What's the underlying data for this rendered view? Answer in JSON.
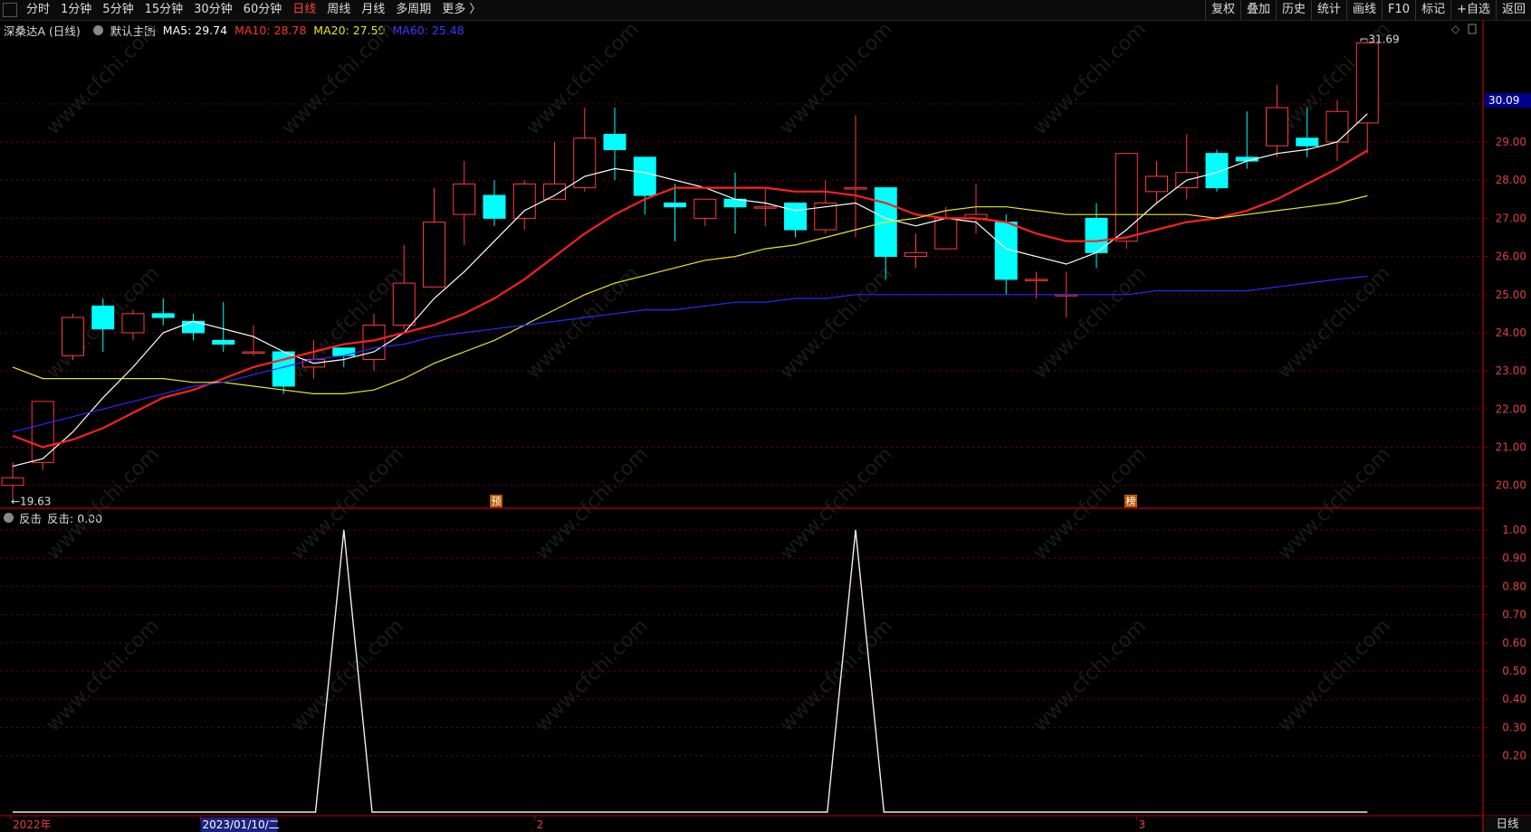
{
  "toolbar": {
    "left": [
      "分时",
      "1分钟",
      "5分钟",
      "15分钟",
      "30分钟",
      "60分钟",
      "日线",
      "周线",
      "月线",
      "多周期",
      "更多 〉"
    ],
    "active_index": 6,
    "right": [
      "复权",
      "叠加",
      "历史",
      "统计",
      "画线",
      "F10",
      "标记",
      "+自选",
      "返回"
    ]
  },
  "main_info": {
    "stock": "深桑达A (日线)",
    "template": "默认主图",
    "ma5": "MA5: 29.74",
    "ma10": "MA10: 28.78",
    "ma20": "MA20: 27.59",
    "ma60": "MA60: 25.48"
  },
  "sub_info": {
    "name": "反击",
    "value": "反击: 0.00"
  },
  "colors": {
    "up": "#ff3b3b",
    "down": "#00ffff",
    "ma5": "#ffffff",
    "ma10": "#ff2020",
    "ma20": "#e6e62a",
    "ma60": "#2a2aff",
    "grid": "#7a0000",
    "axis_text": "#e04040"
  },
  "chart_data": [
    {
      "type": "candlestick",
      "title": "深桑达A (日线)",
      "y_ticks": [
        "30.00",
        "29.00",
        "28.00",
        "27.00",
        "26.00",
        "25.00",
        "24.00",
        "23.00",
        "22.00",
        "21.00",
        "20.00"
      ],
      "ylim": [
        19.4,
        32.2
      ],
      "current_price": "30.09",
      "high_label": "31.69",
      "low_label": "←19.63",
      "markers": [
        "预",
        "榜"
      ],
      "candles": [
        {
          "o": 20.0,
          "c": 20.2,
          "h": 20.6,
          "l": 19.63
        },
        {
          "o": 20.6,
          "c": 22.2,
          "h": 22.2,
          "l": 20.4
        },
        {
          "o": 23.4,
          "c": 24.4,
          "h": 24.5,
          "l": 23.3
        },
        {
          "o": 24.7,
          "c": 24.1,
          "h": 24.9,
          "l": 23.5
        },
        {
          "o": 24.0,
          "c": 24.5,
          "h": 24.6,
          "l": 23.8
        },
        {
          "o": 24.5,
          "c": 24.4,
          "h": 24.9,
          "l": 24.2
        },
        {
          "o": 24.3,
          "c": 24.0,
          "h": 24.5,
          "l": 23.8
        },
        {
          "o": 23.8,
          "c": 23.7,
          "h": 24.8,
          "l": 23.5
        },
        {
          "o": 23.5,
          "c": 23.5,
          "h": 24.2,
          "l": 23.4
        },
        {
          "o": 23.5,
          "c": 22.6,
          "h": 23.5,
          "l": 22.4
        },
        {
          "o": 23.1,
          "c": 23.3,
          "h": 23.8,
          "l": 22.8
        },
        {
          "o": 23.6,
          "c": 23.4,
          "h": 23.6,
          "l": 23.1
        },
        {
          "o": 23.3,
          "c": 24.2,
          "h": 24.5,
          "l": 23.0
        },
        {
          "o": 24.2,
          "c": 25.3,
          "h": 26.3,
          "l": 24.1
        },
        {
          "o": 25.2,
          "c": 26.9,
          "h": 27.8,
          "l": 25.2
        },
        {
          "o": 27.1,
          "c": 27.9,
          "h": 28.5,
          "l": 26.3
        },
        {
          "o": 27.6,
          "c": 27.0,
          "h": 28.0,
          "l": 26.8
        },
        {
          "o": 27.0,
          "c": 27.9,
          "h": 28.0,
          "l": 26.7
        },
        {
          "o": 27.5,
          "c": 27.9,
          "h": 29.0,
          "l": 27.5
        },
        {
          "o": 27.8,
          "c": 29.1,
          "h": 29.9,
          "l": 27.7
        },
        {
          "o": 29.2,
          "c": 28.8,
          "h": 29.9,
          "l": 28.0
        },
        {
          "o": 28.6,
          "c": 27.6,
          "h": 28.6,
          "l": 27.1
        },
        {
          "o": 27.4,
          "c": 27.3,
          "h": 27.9,
          "l": 26.4
        },
        {
          "o": 27.0,
          "c": 27.5,
          "h": 27.5,
          "l": 26.8
        },
        {
          "o": 27.5,
          "c": 27.3,
          "h": 28.2,
          "l": 26.6
        },
        {
          "o": 27.3,
          "c": 27.3,
          "h": 27.8,
          "l": 26.8
        },
        {
          "o": 27.4,
          "c": 26.7,
          "h": 27.4,
          "l": 26.5
        },
        {
          "o": 26.7,
          "c": 27.4,
          "h": 28.0,
          "l": 26.6
        },
        {
          "o": 27.8,
          "c": 27.8,
          "h": 29.7,
          "l": 26.5
        },
        {
          "o": 27.8,
          "c": 26.0,
          "h": 27.8,
          "l": 25.4
        },
        {
          "o": 26.0,
          "c": 26.1,
          "h": 26.6,
          "l": 25.7
        },
        {
          "o": 26.2,
          "c": 27.0,
          "h": 27.3,
          "l": 26.2
        },
        {
          "o": 27.0,
          "c": 27.1,
          "h": 27.9,
          "l": 26.6
        },
        {
          "o": 26.9,
          "c": 25.4,
          "h": 27.1,
          "l": 25.0
        },
        {
          "o": 25.4,
          "c": 25.4,
          "h": 25.6,
          "l": 24.9
        },
        {
          "o": 25.0,
          "c": 25.0,
          "h": 25.6,
          "l": 24.4
        },
        {
          "o": 27.0,
          "c": 26.1,
          "h": 27.4,
          "l": 25.7
        },
        {
          "o": 26.4,
          "c": 28.7,
          "h": 28.7,
          "l": 26.2
        },
        {
          "o": 27.7,
          "c": 28.1,
          "h": 28.5,
          "l": 27.4
        },
        {
          "o": 27.8,
          "c": 28.2,
          "h": 29.2,
          "l": 27.5
        },
        {
          "o": 28.7,
          "c": 27.8,
          "h": 28.8,
          "l": 27.7
        },
        {
          "o": 28.6,
          "c": 28.5,
          "h": 29.8,
          "l": 28.3
        },
        {
          "o": 28.9,
          "c": 29.9,
          "h": 30.5,
          "l": 28.6
        },
        {
          "o": 29.1,
          "c": 28.9,
          "h": 29.9,
          "l": 28.6
        },
        {
          "o": 29.0,
          "c": 29.8,
          "h": 30.1,
          "l": 28.5
        },
        {
          "o": 29.5,
          "c": 31.6,
          "h": 31.69,
          "l": 28.7
        }
      ],
      "ma_series": [
        {
          "name": "MA5",
          "values": [
            20.5,
            20.7,
            21.4,
            22.3,
            23.1,
            24.0,
            24.3,
            24.1,
            23.9,
            23.5,
            23.2,
            23.3,
            23.5,
            24.0,
            24.9,
            25.6,
            26.4,
            27.2,
            27.6,
            28.1,
            28.3,
            28.2,
            28.0,
            27.8,
            27.5,
            27.4,
            27.2,
            27.3,
            27.4,
            27.0,
            26.8,
            27.0,
            26.9,
            26.2,
            26.0,
            25.8,
            26.1,
            26.7,
            27.4,
            28.0,
            28.2,
            28.5,
            28.7,
            28.8,
            29.0,
            29.74
          ]
        },
        {
          "name": "MA10",
          "values": [
            21.3,
            21.0,
            21.2,
            21.5,
            21.9,
            22.3,
            22.5,
            22.8,
            23.1,
            23.3,
            23.5,
            23.7,
            23.8,
            24.0,
            24.2,
            24.5,
            24.9,
            25.4,
            26.0,
            26.6,
            27.1,
            27.5,
            27.8,
            27.8,
            27.8,
            27.8,
            27.7,
            27.7,
            27.6,
            27.4,
            27.1,
            27.0,
            27.0,
            26.9,
            26.6,
            26.4,
            26.4,
            26.5,
            26.7,
            26.9,
            27.0,
            27.2,
            27.5,
            27.9,
            28.3,
            28.78
          ]
        },
        {
          "name": "MA20",
          "values": [
            23.1,
            22.8,
            22.8,
            22.8,
            22.8,
            22.8,
            22.7,
            22.7,
            22.6,
            22.5,
            22.4,
            22.4,
            22.5,
            22.8,
            23.2,
            23.5,
            23.8,
            24.2,
            24.6,
            25.0,
            25.3,
            25.5,
            25.7,
            25.9,
            26.0,
            26.2,
            26.3,
            26.5,
            26.7,
            26.9,
            27.0,
            27.2,
            27.3,
            27.3,
            27.2,
            27.1,
            27.1,
            27.1,
            27.1,
            27.1,
            27.0,
            27.1,
            27.2,
            27.3,
            27.4,
            27.59
          ]
        },
        {
          "name": "MA60",
          "values": [
            21.4,
            21.6,
            21.8,
            22.0,
            22.2,
            22.4,
            22.6,
            22.7,
            22.9,
            23.1,
            23.3,
            23.4,
            23.6,
            23.7,
            23.9,
            24.0,
            24.1,
            24.2,
            24.3,
            24.4,
            24.5,
            24.6,
            24.6,
            24.7,
            24.8,
            24.8,
            24.9,
            24.9,
            25.0,
            25.0,
            25.0,
            25.0,
            25.0,
            25.0,
            25.0,
            25.0,
            25.0,
            25.0,
            25.1,
            25.1,
            25.1,
            25.1,
            25.2,
            25.3,
            25.4,
            25.48
          ]
        }
      ]
    },
    {
      "type": "line",
      "title": "反击",
      "y_ticks": [
        "1.00",
        "0.90",
        "0.80",
        "0.70",
        "0.60",
        "0.50",
        "0.40",
        "0.30",
        "0.20"
      ],
      "ylim": [
        0,
        1
      ],
      "values": [
        0,
        0,
        0,
        0,
        0,
        0,
        0,
        0,
        0,
        0,
        0,
        1,
        0,
        0,
        0,
        0,
        0,
        0,
        0,
        0,
        0,
        0,
        0,
        0,
        0,
        0,
        0,
        0,
        1,
        0,
        0,
        0,
        0,
        0,
        0,
        0,
        0,
        0,
        0,
        0,
        0,
        0,
        0,
        0,
        0,
        0
      ]
    }
  ],
  "x_axis": {
    "labels": [
      "2022年",
      "2023/01/10/二",
      "2",
      "3"
    ],
    "positions_index": [
      0,
      6.3,
      17.4,
      37.4
    ]
  },
  "period_tag": "日线",
  "watermark": "www.cfchi.com"
}
